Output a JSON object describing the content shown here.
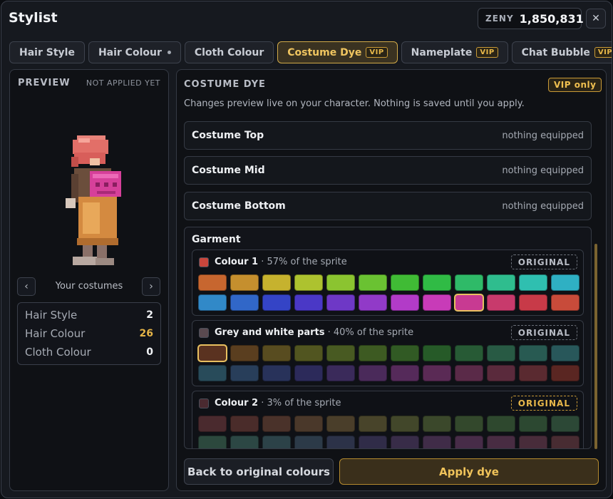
{
  "window": {
    "title": "Stylist",
    "currency_label": "ZENY",
    "currency_value": "1,850,831",
    "close_icon": "✕"
  },
  "tabs": [
    {
      "label": "Hair Style",
      "active": false,
      "badge": "",
      "dot": false
    },
    {
      "label": "Hair Colour",
      "active": false,
      "badge": "",
      "dot": true
    },
    {
      "label": "Cloth Colour",
      "active": false,
      "badge": "",
      "dot": false
    },
    {
      "label": "Costume Dye",
      "active": true,
      "badge": "VIP",
      "dot": false
    },
    {
      "label": "Nameplate",
      "active": false,
      "badge": "VIP",
      "dot": false
    },
    {
      "label": "Chat Bubble",
      "active": false,
      "badge": "VIP",
      "dot": false
    }
  ],
  "preview": {
    "title": "PREVIEW",
    "status": "NOT APPLIED YET",
    "nav_label": "Your costumes",
    "prev_icon": "‹",
    "next_icon": "›",
    "stats": [
      {
        "name": "Hair Style",
        "value": "2",
        "highlight": false
      },
      {
        "name": "Hair Colour",
        "value": "26",
        "highlight": true
      },
      {
        "name": "Cloth Colour",
        "value": "0",
        "highlight": false
      }
    ]
  },
  "main": {
    "title": "COSTUME DYE",
    "vip_label": "VIP only",
    "description": "Changes preview live on your character. Nothing is saved until you apply.",
    "slots": [
      {
        "name": "Costume Top",
        "status": "nothing equipped"
      },
      {
        "name": "Costume Mid",
        "status": "nothing equipped"
      },
      {
        "name": "Costume Bottom",
        "status": "nothing equipped"
      }
    ],
    "garment": {
      "title": "Garment",
      "parts": [
        {
          "name": "Colour 1",
          "pct": " · 57% of the sprite",
          "swatch": "#c9463c",
          "original_label": "ORIGINAL",
          "original_gold": false,
          "selected": 20,
          "colors": [
            "#c7662f",
            "#c58f2e",
            "#c6b22e",
            "#adc22f",
            "#8bc430",
            "#6ac232",
            "#40bb35",
            "#30bb45",
            "#2fba68",
            "#2fbd8e",
            "#2fbfb0",
            "#2fb0c3",
            "#3189c8",
            "#3167c8",
            "#3444c6",
            "#4a38c6",
            "#6e38c6",
            "#913ac8",
            "#b23bc8",
            "#c83bb8",
            "#c83a92",
            "#c83a6c",
            "#c83a48",
            "#c84b3a"
          ]
        },
        {
          "name": "Grey and white parts",
          "pct": " · 40% of the sprite",
          "swatch": "#5a4a50",
          "original_label": "ORIGINAL",
          "original_gold": false,
          "selected": 0,
          "colors": [
            "#5a3220",
            "#5a3e1f",
            "#584c20",
            "#515520",
            "#485a22",
            "#3d5a22",
            "#315a24",
            "#265a28",
            "#275a35",
            "#285a44",
            "#285a52",
            "#28575a",
            "#284b5a",
            "#283e5a",
            "#28325a",
            "#2c2a5a",
            "#3a2a5a",
            "#4a2a5a",
            "#552a5a",
            "#5a2a55",
            "#5a2a48",
            "#5a2a3c",
            "#5a2a30",
            "#5a2622"
          ]
        },
        {
          "name": "Colour 2",
          "pct": " · 3% of the sprite",
          "swatch": "#4a2a30",
          "original_label": "ORIGINAL",
          "original_gold": true,
          "selected": -1,
          "colors": [
            "#4a2a2e",
            "#4a2c2a",
            "#4a322a",
            "#4a382a",
            "#4a3e2a",
            "#48442a",
            "#42472a",
            "#3b482b",
            "#33482c",
            "#2e482e",
            "#2c4831",
            "#2c4836",
            "#2c483d",
            "#2c4744",
            "#2c4248",
            "#2c3a48",
            "#2c3248",
            "#302c48",
            "#382c48",
            "#402c48",
            "#472c48",
            "#482c42",
            "#482c3a",
            "#482c32"
          ]
        }
      ]
    },
    "buttons": {
      "back": "Back to original colours",
      "apply": "Apply dye"
    }
  },
  "colors": {
    "accent_gold": "#f0c35a",
    "panel_bg": "#0f1115",
    "window_bg": "#16191f"
  }
}
